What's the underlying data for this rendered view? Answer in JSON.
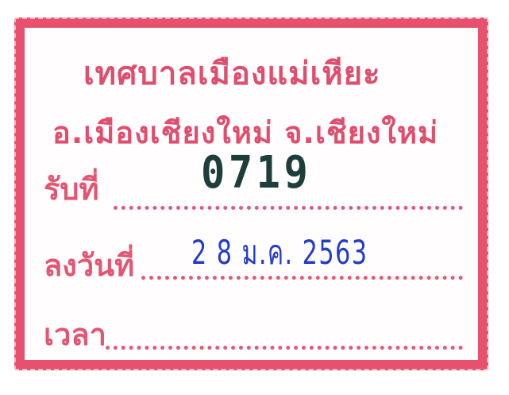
{
  "stamp": {
    "office_name": "เทศบาลเมืองแม่เหียะ",
    "district_province": "อ.เมืองเชียงใหม่ จ.เชียงใหม่",
    "received_label": "รับที่",
    "received_number": "0719",
    "date_label": "ลงวันที่",
    "date_value": "2 8 ม.ค. 2563",
    "time_label": "เวลา",
    "time_value": ""
  },
  "colors": {
    "stamp_red": "#de3f61",
    "handwriting": "#1d3e3b",
    "date_blue": "#233dc8",
    "background": "#ffffff"
  }
}
